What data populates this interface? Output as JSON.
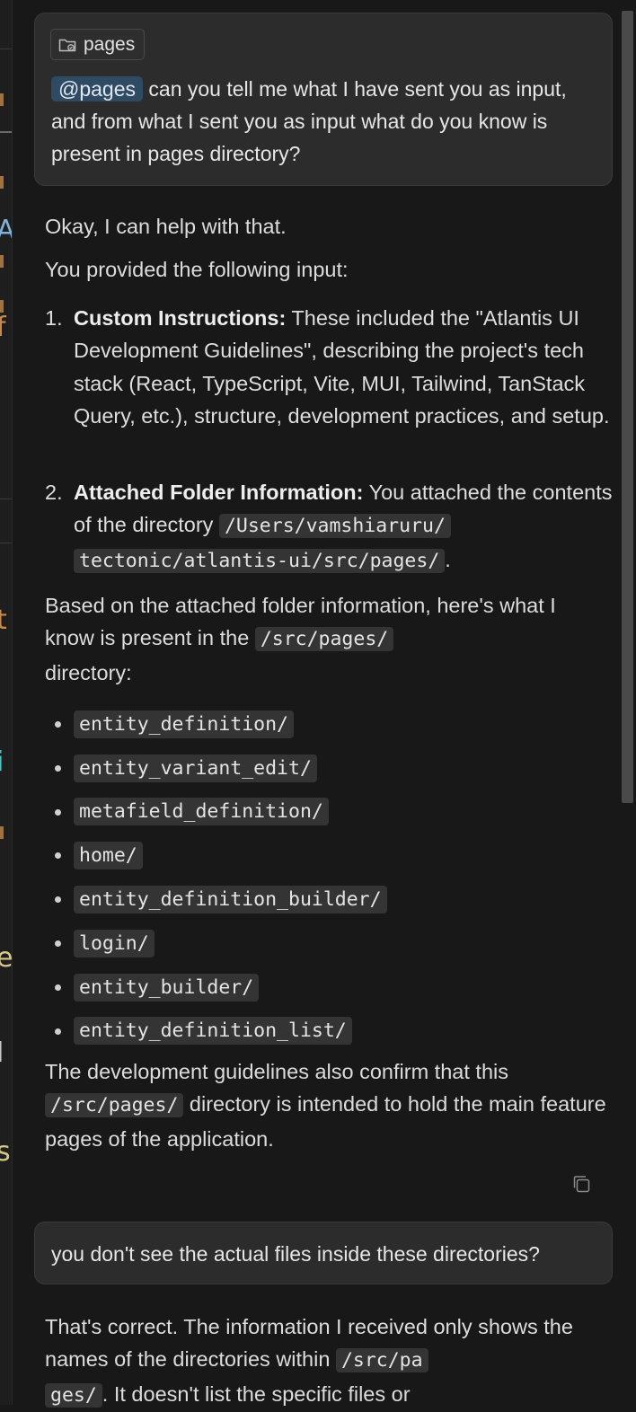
{
  "user_message_1": {
    "context_chip_label": "pages",
    "mention": "@pages",
    "text": " can you tell me what I have sent you as input, and from what I sent you as input what do you know is present in pages directory?"
  },
  "assistant_message_1": {
    "intro": "Okay, I can help with that.",
    "lead": "You provided the following input:",
    "items": [
      {
        "number": "1.",
        "title": "Custom Instructions:",
        "text": " These included the \"Atlantis UI Development Guidelines\", describing the project's tech stack (React, TypeScript, Vite, MUI, Tailwind, TanStack Query, etc.), structure, development practices, and setup."
      },
      {
        "number": "2.",
        "title": "Attached Folder Information:",
        "text_before": " You attached the contents of the directory ",
        "code_part1": "/Users/vamshiaruru/",
        "code_part2": "tectonic/atlantis-ui/src/pages/",
        "text_after": "."
      }
    ],
    "based_pre": "Based on the attached folder information, here's what I know is present in the ",
    "based_code": "/src/pages/",
    "based_post": " directory:",
    "directories": [
      "entity_definition/",
      "entity_variant_edit/",
      "metafield_definition/",
      "home/",
      "entity_definition_builder/",
      "login/",
      "entity_builder/",
      "entity_definition_list/"
    ],
    "closing_pre": "The development guidelines also confirm that this ",
    "closing_code": "/src/pages/",
    "closing_post": " directory is intended to hold the main feature pages of the application."
  },
  "user_message_2": {
    "text": "you don't see the actual files inside these directories?"
  },
  "assistant_message_2": {
    "pre": "That's correct. The information I received only shows the names of the directories within ",
    "code_part1": "/src/pa",
    "code_part2": "ges/",
    "post": ". It doesn't list the specific files or"
  },
  "icons": {
    "folder": "folder-icon",
    "copy": "copy-icon"
  },
  "colors": {
    "background": "#181818",
    "bubble": "#2c2c2c",
    "mention_bg": "#2f4a63",
    "code_bg": "#343434",
    "text": "#dcdcdc"
  }
}
